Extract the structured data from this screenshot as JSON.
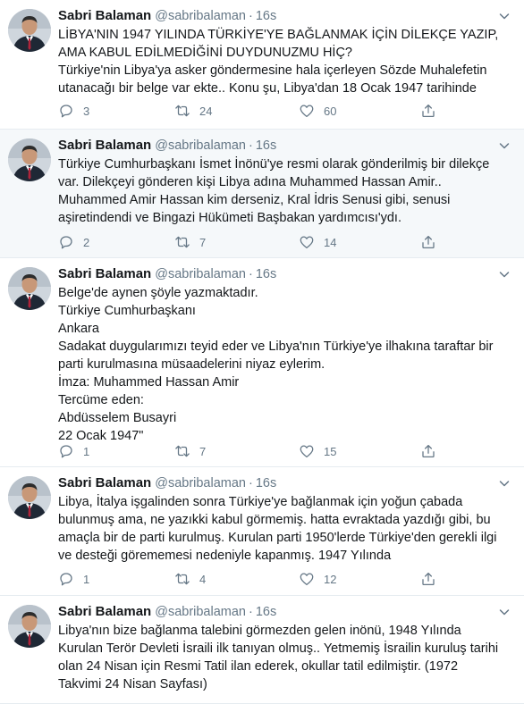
{
  "tweets": [
    {
      "name": "Sabri Balaman",
      "handle": "@sabribalaman",
      "time": "16s",
      "lines": [
        "LİBYA'NIN 1947 YILINDA TÜRKİYE'YE BAĞLANMAK İÇİN DİLEKÇE YAZIP,",
        "AMA KABUL EDİLMEDİĞİNİ DUYDUNUZMU HİÇ?",
        "Türkiye'nin Libya'ya asker göndermesine hala içerleyen Sözde Muhalefetin",
        "utanacağı bir belge var ekte.. Konu şu, Libya'dan 18 Ocak 1947 tarihinde"
      ],
      "replies": "3",
      "retweets": "24",
      "likes": "60"
    },
    {
      "name": "Sabri Balaman",
      "handle": "@sabribalaman",
      "time": "16s",
      "lines": [
        "Türkiye Cumhurbaşkanı İsmet İnönü'ye resmi olarak gönderilmiş bir dilekçe",
        "var. Dilekçeyi gönderen kişi Libya adına Muhammed Hassan Amir..",
        "Muhammed Amir Hassan kim derseniz, Kral İdris Senusi gibi, senusi",
        "aşiretindendi ve Bingazi Hükümeti Başbakan yardımcısı'ydı."
      ],
      "replies": "2",
      "retweets": "7",
      "likes": "14"
    },
    {
      "name": "Sabri Balaman",
      "handle": "@sabribalaman",
      "time": "16s",
      "lines": [
        "Belge'de aynen şöyle yazmaktadır.",
        "Türkiye Cumhurbaşkanı",
        "Ankara",
        "Sadakat duygularımızı teyid eder ve Libya'nın Türkiye'ye ilhakına taraftar bir",
        "parti kurulmasına müsaadelerini niyaz eylerim.",
        "İmza: Muhammed Hassan Amir",
        "Tercüme eden:",
        "Abdüsselem Busayri",
        "22 Ocak 1947\""
      ],
      "replies": "1",
      "retweets": "7",
      "likes": "15"
    },
    {
      "name": "Sabri Balaman",
      "handle": "@sabribalaman",
      "time": "16s",
      "lines": [
        "Libya, İtalya işgalinden sonra Türkiye'ye bağlanmak için yoğun çabada",
        "bulunmuş ama, ne yazıkki kabul görmemiş. hatta evraktada yazdığı gibi, bu",
        "amaçla bir de parti kurulmuş. Kurulan parti 1950'lerde Türkiye'den gerekli ilgi",
        "ve desteği görememesi nedeniyle kapanmış. 1947 Yılında"
      ],
      "replies": "1",
      "retweets": "4",
      "likes": "12"
    },
    {
      "name": "Sabri Balaman",
      "handle": "@sabribalaman",
      "time": "16s",
      "lines": [
        "Libya'nın bize bağlanma talebini görmezden gelen inönü, 1948 Yılında",
        "Kurulan Terör Devleti İsraili ilk tanıyan olmuş.. Yetmemiş İsrailin kuruluş tarihi",
        "olan 24 Nisan için Resmi Tatil ilan ederek, okullar tatil edilmiştir. (1972",
        "Takvimi 24 Nisan Sayfası)"
      ],
      "replies": "",
      "retweets": "",
      "likes": ""
    }
  ],
  "icons": {
    "reply": "reply-icon",
    "retweet": "retweet-icon",
    "like": "heart-icon",
    "share": "share-icon",
    "more": "chevron-down-icon"
  },
  "colors": {
    "text": "#14171a",
    "secondary": "#657786",
    "alt_background": "#f5f8fa",
    "divider": "#e6ecf0"
  }
}
